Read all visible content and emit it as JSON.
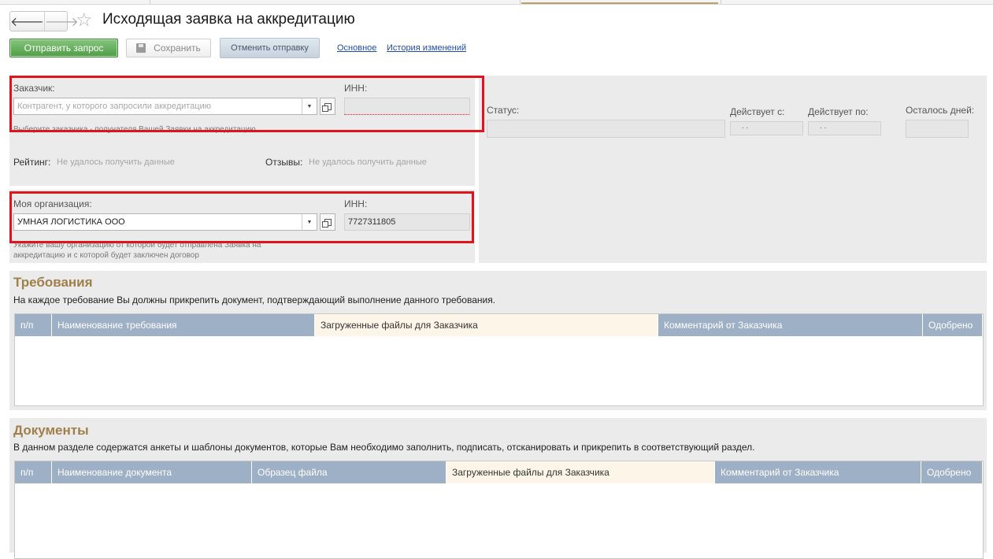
{
  "window": {
    "title": "Исходящая заявка на аккредитацию",
    "nav_back": "🡐",
    "nav_forward": "🡒",
    "favorite_icon": "☆"
  },
  "toolbar": {
    "send_label": "Отправить запрос",
    "save_label": "Сохранить",
    "cancel_send_label": "Отменить отправку",
    "link_main": "Основное",
    "link_history": "История изменений"
  },
  "customer": {
    "label": "Заказчик:",
    "placeholder": "Контрагент, у которого запросили аккредитацию",
    "hint": "Выберите заказчика - получателя Вашей Заявки на аккредитацию",
    "inn_label": "ИНН:",
    "inn_value": "",
    "rating_label": "Рейтинг:",
    "rating_value": "Не удалось получить данные",
    "reviews_label": "Отзывы:",
    "reviews_value": "Не удалось получить данные"
  },
  "my_org": {
    "label": "Моя организация:",
    "value": "УМНАЯ ЛОГИСТИКА ООО",
    "hint": "Укажите вашу организацию от которой будет отправлена Заявка на аккредитацию и с которой будет заключен договор",
    "inn_label": "ИНН:",
    "inn_value": "7727311805"
  },
  "status": {
    "status_label": "Статус:",
    "valid_from_label": "Действует с:",
    "valid_from_value": ". .",
    "valid_to_label": "Действует по:",
    "valid_to_value": ". .",
    "days_left_label": "Осталось дней:"
  },
  "requirements": {
    "title": "Требования",
    "description": "На каждое требование Вы должны прикрепить документ, подтверждающий выполнение данного требования.",
    "columns": [
      "п/п",
      "Наименование требования",
      "Загруженные файлы для Заказчика",
      "Комментарий от Заказчика",
      "Одобрено"
    ]
  },
  "documents": {
    "title": "Документы",
    "description": "В данном разделе содержатся анкеты и шаблоны документов, которые Вам необходимо заполнить, подписать, отсканировать и прикрепить в соответствующий раздел.",
    "columns": [
      "п/п",
      "Наименование документа",
      "Образец файла",
      "Загруженные файлы для Заказчика",
      "Комментарий от Заказчика",
      "Одобрено"
    ]
  },
  "colors": {
    "accent_green": "#4f9d46",
    "section_title": "#a0804a",
    "grid_header": "#9eb0c5",
    "highlight_red": "#e0141e"
  }
}
